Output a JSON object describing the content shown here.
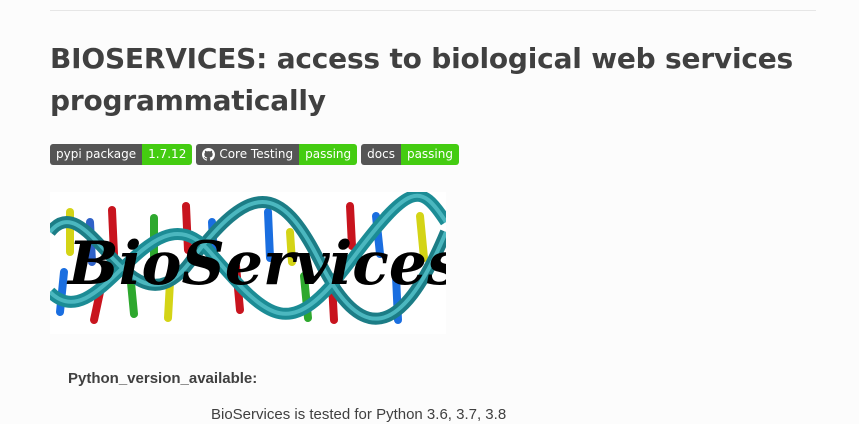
{
  "title": "BIOSERVICES: access to biological web services programmatically",
  "badges": [
    {
      "left": "pypi package",
      "right": "1.7.12",
      "right_color": "#4c1"
    },
    {
      "left": "Core Testing",
      "right": "passing",
      "right_color": "#4c1",
      "icon": "github-icon"
    },
    {
      "left": "docs",
      "right": "passing",
      "right_color": "#4c1"
    }
  ],
  "logo": {
    "text": "BioServices"
  },
  "field": {
    "name": "Python_version_available:",
    "body": "BioServices is tested for Python 3.6, 3.7, 3.8"
  }
}
